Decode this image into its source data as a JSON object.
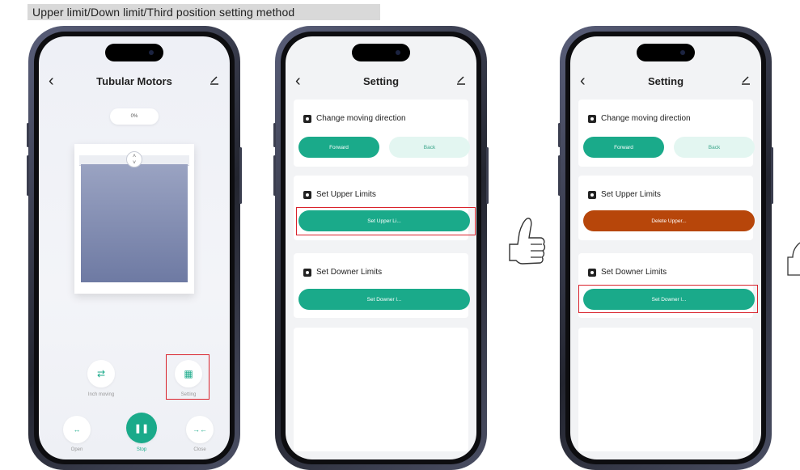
{
  "banner": "Upper limit/Down limit/Third position setting method",
  "phone1": {
    "title": "Tubular Motors",
    "percent": "0%",
    "inch_label": "Inch moving",
    "setting_label": "Setting",
    "open_label": "Open",
    "stop_label": "Stop",
    "close_label": "Close"
  },
  "phone2": {
    "title": "Setting",
    "direction_title": "Change moving direction",
    "forward": "Forward",
    "back": "Back",
    "upper_title": "Set Upper Limits",
    "upper_btn": "Set Upper Li...",
    "downer_title": "Set Downer Limits",
    "downer_btn": "Set Downer l..."
  },
  "phone3": {
    "title": "Setting",
    "direction_title": "Change moving direction",
    "forward": "Forward",
    "back": "Back",
    "upper_title": "Set Upper Limits",
    "upper_btn": "Delete Upper...",
    "downer_title": "Set Downer Limits",
    "downer_btn": "Set Downer l..."
  },
  "colors": {
    "accent": "#1aaa8a",
    "delete": "#b7460a",
    "highlight": "#d9232c"
  }
}
